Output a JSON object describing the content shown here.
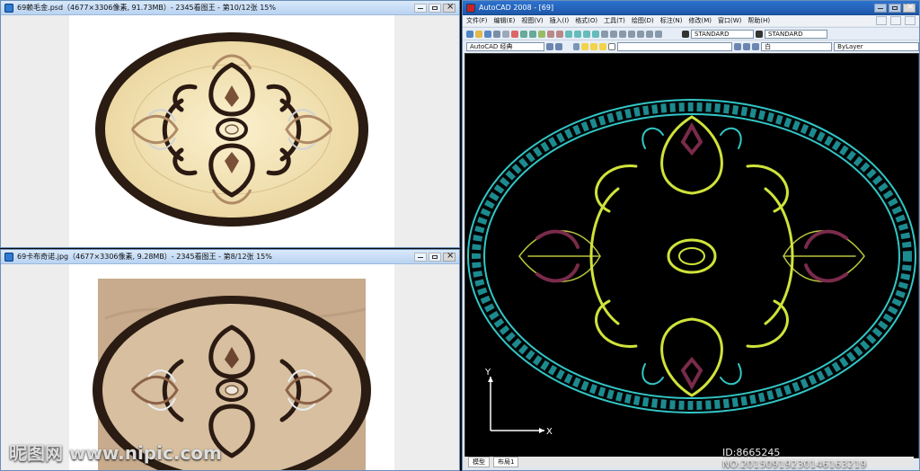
{
  "viewer1": {
    "title": "69赖毛金.psd（4677×3306像素, 91.73MB）- 2345看图王 - 第10/12张 15%"
  },
  "viewer2": {
    "title": "69卡布奇诺.jpg（4677×3306像素, 9.28MB）- 2345看图王 - 第8/12张 15%"
  },
  "autocad": {
    "title": "AutoCAD 2008 - [69]",
    "menu": [
      "文件(F)",
      "编辑(E)",
      "视图(V)",
      "插入(I)",
      "格式(O)",
      "工具(T)",
      "绘图(D)",
      "标注(N)",
      "修改(M)",
      "窗口(W)",
      "帮助(H)"
    ],
    "workspace": "AutoCAD 经典",
    "text_style": "STANDARD",
    "dim_style": "STANDARD",
    "layer": "白",
    "linetype": "ByLayer",
    "tabs": [
      "模型",
      "布局1"
    ],
    "axes": {
      "x": "X",
      "y": "Y"
    }
  },
  "watermarks": {
    "left": "昵图网 www.nipic.com",
    "right": "ID:8665245 NO:20150919230146163219"
  }
}
